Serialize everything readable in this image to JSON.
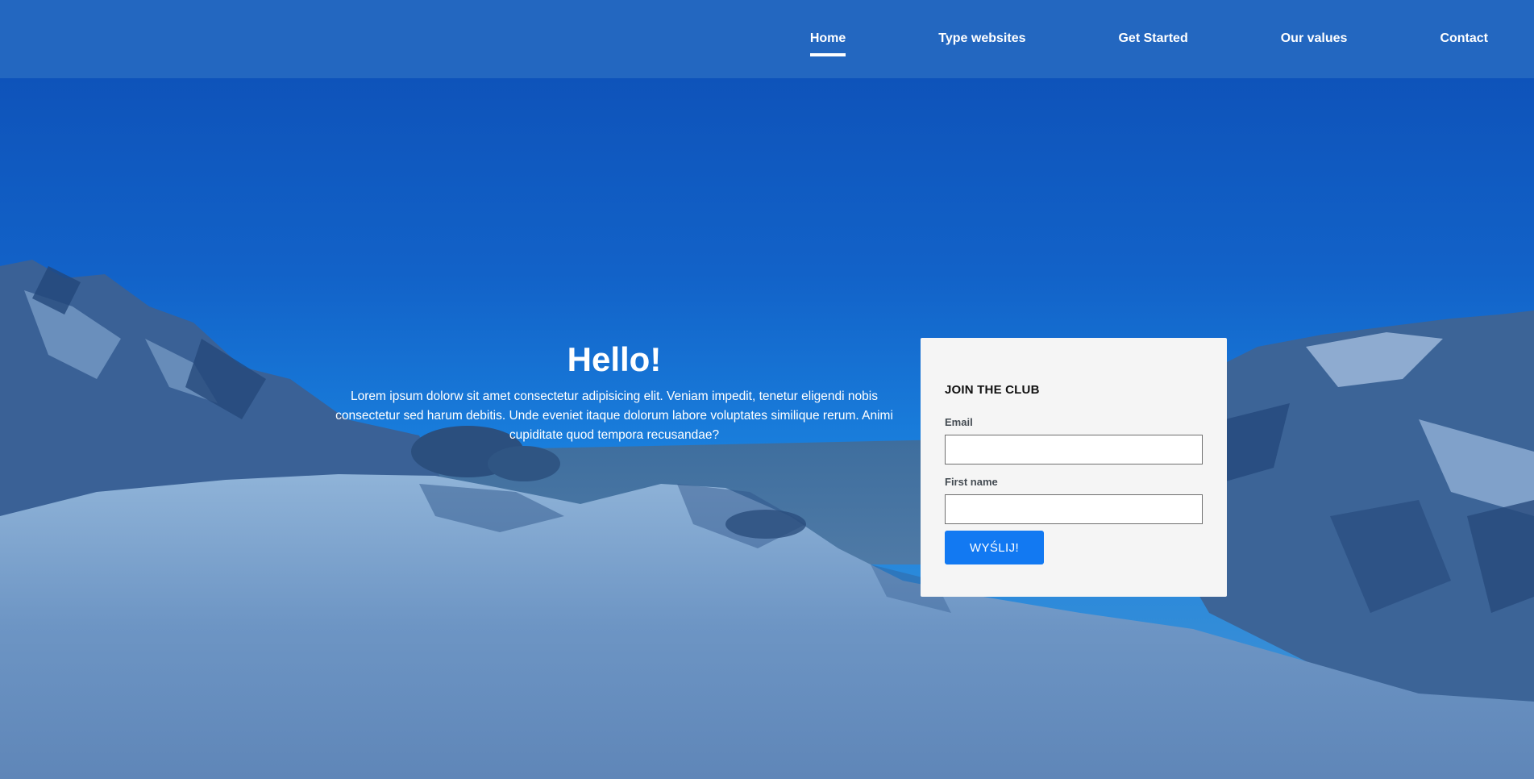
{
  "nav": {
    "items": [
      {
        "label": "Home",
        "active": true
      },
      {
        "label": "Type websites",
        "active": false
      },
      {
        "label": "Get Started",
        "active": false
      },
      {
        "label": "Our values",
        "active": false
      },
      {
        "label": "Contact",
        "active": false
      }
    ]
  },
  "hero": {
    "title": "Hello!",
    "text": "Lorem ipsum dolorw sit amet consectetur adipisicing elit. Veniam impedit, tenetur eligendi nobis consectetur sed harum debitis. Unde eveniet itaque dolorum labore voluptates similique rerum. Animi cupiditate quod tempora recusandae?"
  },
  "form": {
    "title": "JOIN THE CLUB",
    "email_label": "Email",
    "email_value": "",
    "first_name_label": "First name",
    "first_name_value": "",
    "submit_label": "WYŚLIJ!"
  },
  "colors": {
    "navbar": "#2367c0",
    "sky_top": "#0b4fb6",
    "sky_bottom": "#1a86e3",
    "card_bg": "#f5f5f5",
    "button": "#1279f2"
  }
}
